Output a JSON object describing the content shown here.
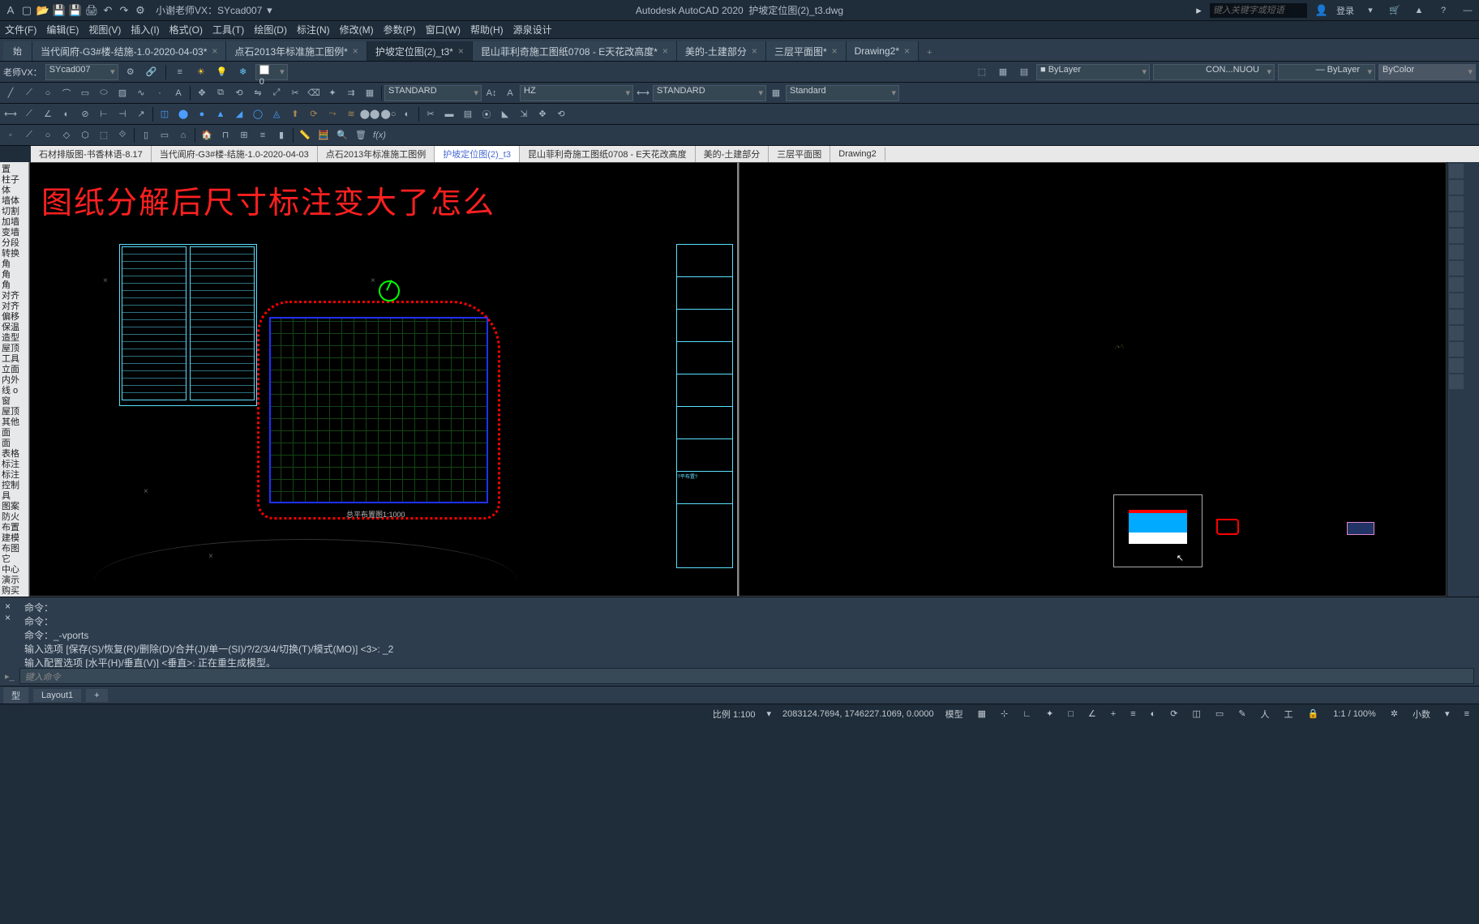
{
  "title": {
    "app": "Autodesk AutoCAD 2020",
    "file": "护坡定位图(2)_t3.dwg",
    "vx": "小谢老师VX：SYcad007"
  },
  "search_placeholder": "键入关键字或短语",
  "login": "登录",
  "menus": [
    "文件(F)",
    "编辑(E)",
    "视图(V)",
    "插入(I)",
    "格式(O)",
    "工具(T)",
    "绘图(D)",
    "标注(N)",
    "修改(M)",
    "参数(P)",
    "窗口(W)",
    "帮助(H)",
    "源泉设计"
  ],
  "doc_tabs": [
    {
      "label": "当代阆府-G3#楼-结施-1.0-2020-04-03*",
      "active": false
    },
    {
      "label": "点石2013年标准施工图例*",
      "active": false
    },
    {
      "label": "护坡定位图(2)_t3*",
      "active": true
    },
    {
      "label": "昆山菲利奇施工图纸0708 - E天花改高度*",
      "active": false
    },
    {
      "label": "美的-土建部分",
      "active": false
    },
    {
      "label": "三层平面图*",
      "active": false
    },
    {
      "label": "Drawing2*",
      "active": false
    }
  ],
  "start_tab": "始",
  "prop_row": {
    "vx_box": "老师VX：",
    "vx_val": "SYcad007",
    "layer": "0",
    "layer_style": "ByLayer",
    "linetype": "CON...NUOU",
    "lineweight": "ByLayer",
    "color": "ByColor"
  },
  "style_row": {
    "text_style": "STANDARD",
    "dim_style": "HZ",
    "s2": "STANDARD",
    "tbl": "Standard"
  },
  "viewport_tabs": [
    "石材排版图-书香林语-8.17",
    "当代阆府-G3#楼-结施-1.0-2020-04-03",
    "点石2013年标准施工图例",
    "护坡定位图(2)_t3",
    "昆山菲利奇施工图纸0708 - E天花改高度",
    "美的-土建部分",
    "三层平面图",
    "Drawing2"
  ],
  "viewport_active": "护坡定位图(2)_t3",
  "left_panel": [
    "置",
    "柱子",
    "体",
    "墙体",
    "切割",
    "加墙",
    "变墙",
    "分段",
    "转换",
    "角",
    "角",
    "角",
    "对齐",
    "对齐",
    "偏移",
    "保温",
    "造型",
    "屋顶",
    "工具",
    "立面",
    "内外",
    "线 o",
    "窗",
    "屋顶",
    "其他",
    "面",
    "面",
    "表格",
    "标注",
    "标注",
    "控制",
    "具",
    "图案",
    "防火",
    "布置",
    "建模",
    "布图",
    "它",
    "中心",
    "演示",
    "购买"
  ],
  "drawing_headline": "图纸分解后尺寸标注变大了怎么",
  "plan_label": "总平布置图1:1000",
  "plan_q": "?平布置?",
  "cmd": {
    "l1": "命令：",
    "l2": "命令：",
    "l3": "命令：_-vports",
    "l4": "输入选项 [保存(S)/恢复(R)/删除(D)/合并(J)/单一(SI)/?/2/3/4/切换(T)/模式(MO)] <3>: _2",
    "l5": "输入配置选项 [水平(H)/垂直(V)] <垂直>:  正在重生成模型。",
    "prompt": "键入命令"
  },
  "layout_tabs": {
    "model": "型",
    "layout": "Layout1"
  },
  "status": {
    "scale_lbl": "比例 1:100",
    "coords": "2083124.7694, 1746227.1069, 0.0000",
    "work": "工",
    "ratio": "1:1 / 100%",
    "decimal": "小数"
  }
}
